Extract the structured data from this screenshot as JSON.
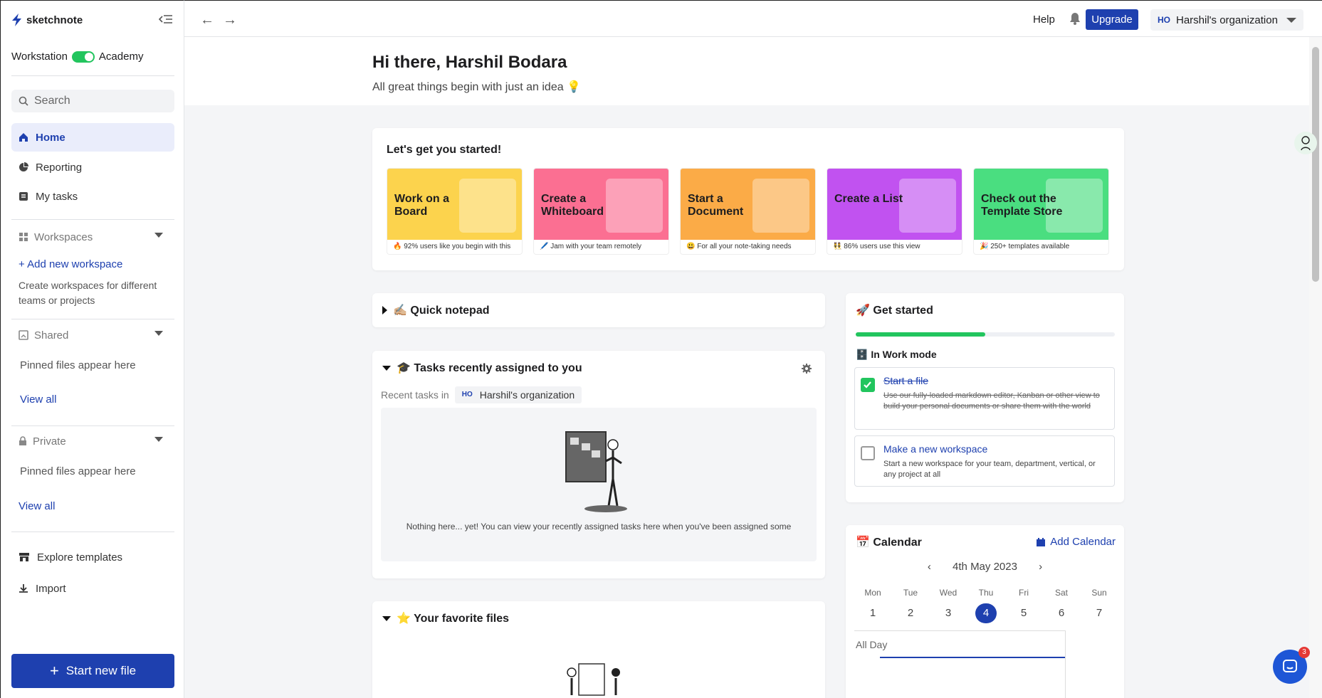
{
  "app": {
    "name": "sketchnote"
  },
  "sidebar": {
    "mode_left": "Workstation",
    "mode_right": "Academy",
    "search_placeholder": "Search",
    "nav": [
      {
        "label": "Home"
      },
      {
        "label": "Reporting"
      },
      {
        "label": "My tasks"
      }
    ],
    "workspaces": {
      "label": "Workspaces",
      "add": "Add new workspace",
      "hint": "Create workspaces for different teams or projects"
    },
    "shared": {
      "label": "Shared",
      "hint": "Pinned files appear here",
      "view_all": "View all"
    },
    "private": {
      "label": "Private",
      "hint": "Pinned files appear here",
      "view_all": "View all"
    },
    "explore": "Explore templates",
    "import": "Import",
    "start_new": "Start new file"
  },
  "topbar": {
    "help": "Help",
    "upgrade": "Upgrade",
    "org_badge": "HO",
    "org_name": "Harshil's organization"
  },
  "hero": {
    "greeting": "Hi there, Harshil Bodara",
    "subtitle": "All great things begin with just an idea 💡"
  },
  "started": {
    "title": "Let's get you started!",
    "tiles": [
      {
        "label": "Work on a Board",
        "caption": "🔥 92% users like you begin with this",
        "color": "#fcd34d"
      },
      {
        "label": "Create a Whiteboard",
        "caption": "🖊️ Jam with your team remotely",
        "color": "#fb6f92"
      },
      {
        "label": "Start a Document",
        "caption": "😃 For all your note-taking needs",
        "color": "#fbab47"
      },
      {
        "label": "Create a List",
        "caption": "👯 86% users use this view",
        "color": "#c152f0"
      },
      {
        "label": "Check out the Template Store",
        "caption": "🎉 250+ templates available",
        "color": "#4ade80"
      }
    ]
  },
  "notepad": {
    "title": "✍🏼 Quick notepad"
  },
  "tasks": {
    "title": "🎓 Tasks recently assigned to you",
    "recent_in": "Recent tasks in",
    "org_badge": "HO",
    "org_name": "Harshil's organization",
    "empty": "Nothing here... yet! You can view your recently assigned tasks here when you've been assigned some"
  },
  "favorites": {
    "title": "⭐ Your favorite files"
  },
  "get_started": {
    "title": "🚀 Get started",
    "progress": 0.5,
    "mode": "🗄️ In Work mode",
    "items": [
      {
        "title": "Start a file",
        "desc": "Use our fully-loaded markdown editor, Kanban or other view to build your personal documents or share them with the world",
        "done": true
      },
      {
        "title": "Make a new workspace",
        "desc": "Start a new workspace for your team, department, vertical, or any project at all",
        "done": false
      }
    ]
  },
  "calendar": {
    "title": "📅 Calendar",
    "add": "Add Calendar",
    "date": "4th May 2023",
    "days": [
      "Mon",
      "Tue",
      "Wed",
      "Thu",
      "Fri",
      "Sat",
      "Sun"
    ],
    "nums": [
      "1",
      "2",
      "3",
      "4",
      "5",
      "6",
      "7"
    ],
    "today_index": 3,
    "all_day": "All Day"
  },
  "chat": {
    "count": "3"
  }
}
